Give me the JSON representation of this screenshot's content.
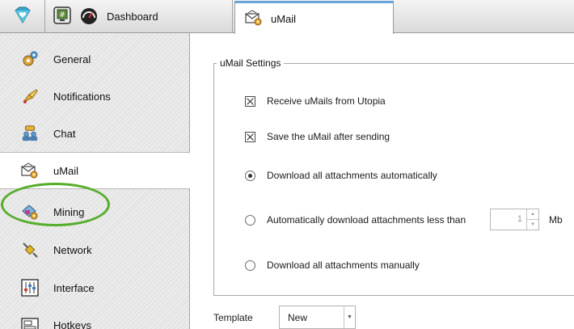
{
  "tabs": {
    "app_icon": "diamond-heart-icon",
    "dashboard": {
      "icon": "grid-icon",
      "gauge_icon": "speedometer-icon",
      "label": "Dashboard"
    },
    "umail": {
      "icon": "envelope-gear-icon",
      "label": "uMail"
    }
  },
  "sidebar": {
    "items": [
      {
        "label": "General",
        "icon": "gears-icon"
      },
      {
        "label": "Notifications",
        "icon": "trumpet-icon"
      },
      {
        "label": "Chat",
        "icon": "chat-people-icon"
      },
      {
        "label": "uMail",
        "icon": "envelope-gear-icon",
        "selected": true
      },
      {
        "label": "Mining",
        "icon": "mining-gear-icon"
      },
      {
        "label": "Network",
        "icon": "plug-icon"
      },
      {
        "label": "Interface",
        "icon": "sliders-icon"
      },
      {
        "label": "Hotkeys",
        "icon": "keyboard-icon"
      }
    ],
    "highlight_color": "#57ad2c"
  },
  "settings": {
    "group_title": "uMail Settings",
    "receive_label": "Receive uMails from Utopia",
    "receive_checked": true,
    "save_label": "Save the uMail after sending",
    "save_checked": true,
    "download_mode": "auto",
    "opt_auto": "Download all attachments automatically",
    "opt_less_than": "Automatically download attachments less than",
    "opt_manual": "Download all attachments manually",
    "size_value": "1",
    "size_unit": "Mb"
  },
  "template": {
    "label": "Template",
    "value": "New"
  },
  "colors": {
    "accent": "#6aa3d8",
    "highlight": "#57ad2c"
  }
}
